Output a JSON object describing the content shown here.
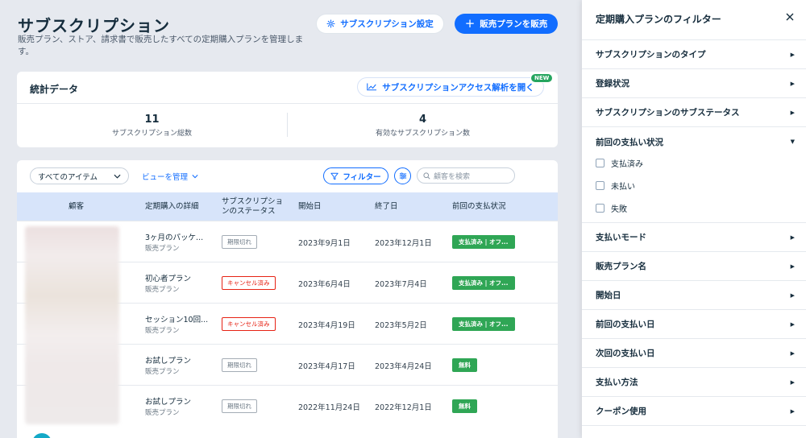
{
  "header": {
    "title": "サブスクリプション",
    "description": "販売プラン、ストア、請求書で販売したすべての定期購入プランを管理します。",
    "settings_label": "サブスクリプション設定",
    "sell_label": "販売プランを販売"
  },
  "stats": {
    "title": "統計データ",
    "analytics_label": "サブスクリプションアクセス解析を開く",
    "new_badge": "NEW",
    "total_value": "11",
    "total_label": "サブスクリプション総数",
    "active_value": "4",
    "active_label": "有効なサブスクリプション数"
  },
  "toolbar": {
    "all_items": "すべてのアイテム",
    "view_manage": "ビューを管理",
    "filter_label": "フィルター",
    "search_placeholder": "顧客を検索"
  },
  "table": {
    "columns": {
      "customer": "顧客",
      "plan_detail": "定期購入の詳細",
      "sub_status_1": "サブスクリプショ",
      "sub_status_2": "ンのステータス",
      "start_date": "開始日",
      "end_date": "終了日",
      "last_payment": "前回の支払状況"
    },
    "rows": [
      {
        "plan": "3ヶ月のパッケ...",
        "type": "販売プラン",
        "status": "期限切れ",
        "start": "2023年9月1日",
        "end": "2023年12月1日",
        "payment": "支払済み | オフ..."
      },
      {
        "plan": "初心者プラン",
        "type": "販売プラン",
        "status": "キャンセル済み",
        "start": "2023年6月4日",
        "end": "2023年7月4日",
        "payment": "支払済み | オフ..."
      },
      {
        "plan": "セッション10回...",
        "type": "販売プラン",
        "status": "キャンセル済み",
        "start": "2023年4月19日",
        "end": "2023年5月2日",
        "payment": "支払済み | オフ..."
      },
      {
        "plan": "お試しプラン",
        "type": "販売プラン",
        "status": "期限切れ",
        "start": "2023年4月17日",
        "end": "2023年4月24日",
        "payment": "無料"
      },
      {
        "plan": "お試しプラン",
        "type": "販売プラン",
        "status": "期限切れ",
        "start": "2022年11月24日",
        "end": "2022年12月1日",
        "payment": "無料"
      }
    ]
  },
  "panel": {
    "title": "定期購入プランのフィルター",
    "filters": {
      "sub_type": "サブスクリプションのタイプ",
      "registration": "登録状況",
      "sub_status": "サブスクリプションのサブステータス",
      "last_payment": "前回の支払い状況",
      "payment_mode": "支払いモード",
      "plan_name": "販売プラン名",
      "start_date": "開始日",
      "last_payment_date": "前回の支払い日",
      "next_payment_date": "次回の支払い日",
      "payment_method": "支払い方法",
      "coupon": "クーポン使用"
    },
    "options": {
      "paid": "支払済み",
      "unpaid": "未払い",
      "failed": "失敗"
    }
  },
  "colors": {
    "accent": "#116dff",
    "paid": "#2fa655",
    "cancel": "#e62214",
    "header_row": "#d7e4fa"
  }
}
